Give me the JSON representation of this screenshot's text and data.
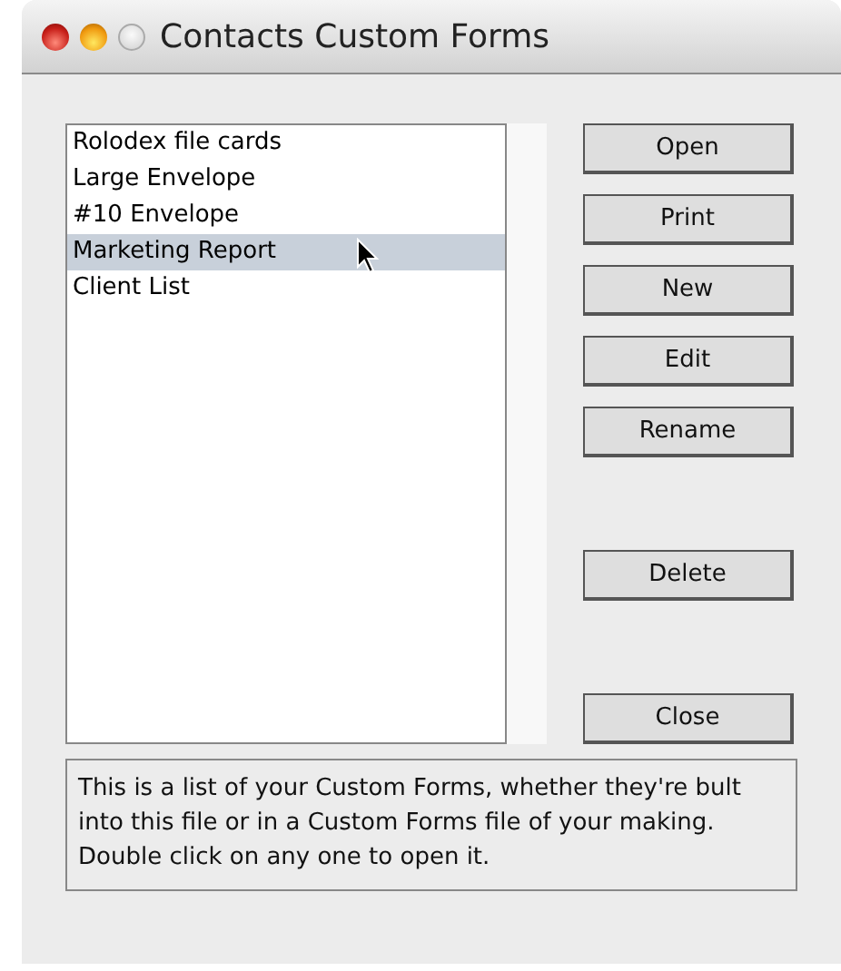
{
  "window": {
    "title": "Contacts Custom Forms"
  },
  "forms": [
    {
      "label": "Rolodex file cards",
      "selected": false
    },
    {
      "label": "Large Envelope",
      "selected": false
    },
    {
      "label": "#10 Envelope",
      "selected": false
    },
    {
      "label": "Marketing Report",
      "selected": true
    },
    {
      "label": "Client List",
      "selected": false
    }
  ],
  "button_groups": [
    [
      "Open",
      "Print",
      "New",
      "Edit",
      "Rename"
    ],
    [
      "Delete"
    ],
    [
      "Close"
    ]
  ],
  "description": "This is a list of your Custom Forms, whether they're bult into this file or in a Custom Forms file of your making. Double click on any one to open it."
}
